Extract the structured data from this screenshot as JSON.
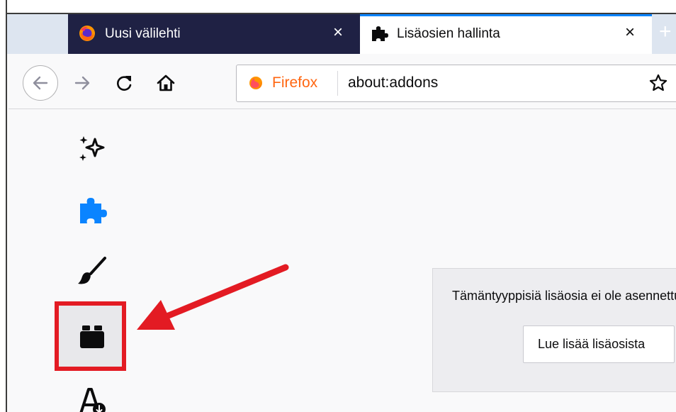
{
  "browser": {
    "tabs": [
      {
        "label": "Uusi välilehti",
        "icon": "firefox-icon",
        "active": false
      },
      {
        "label": "Lisäosien hallinta",
        "icon": "puzzle-icon",
        "active": true
      }
    ],
    "close_glyph": "×",
    "new_tab_glyph": "+",
    "identity_label": "Firefox",
    "url": "about:addons"
  },
  "sidebar": {
    "categories": [
      {
        "name": "recommendations",
        "icon": "sparkle-icon"
      },
      {
        "name": "extensions",
        "icon": "puzzle-icon"
      },
      {
        "name": "themes",
        "icon": "brush-icon"
      },
      {
        "name": "plugins",
        "icon": "plugin-block-icon",
        "highlighted": true
      },
      {
        "name": "languages",
        "icon": "language-icon"
      }
    ]
  },
  "main": {
    "empty_message": "Tämäntyyppisiä lisäosia ei ole asennettu",
    "learn_more_label": "Lue lisää lisäosista"
  },
  "annotation": {
    "highlight_color": "#e31b23",
    "arrow_color": "#e31b23"
  },
  "colors": {
    "accent": "#0a84ff",
    "inactive_tab": "#1f2144",
    "firefox_orange": "#ff6611"
  }
}
